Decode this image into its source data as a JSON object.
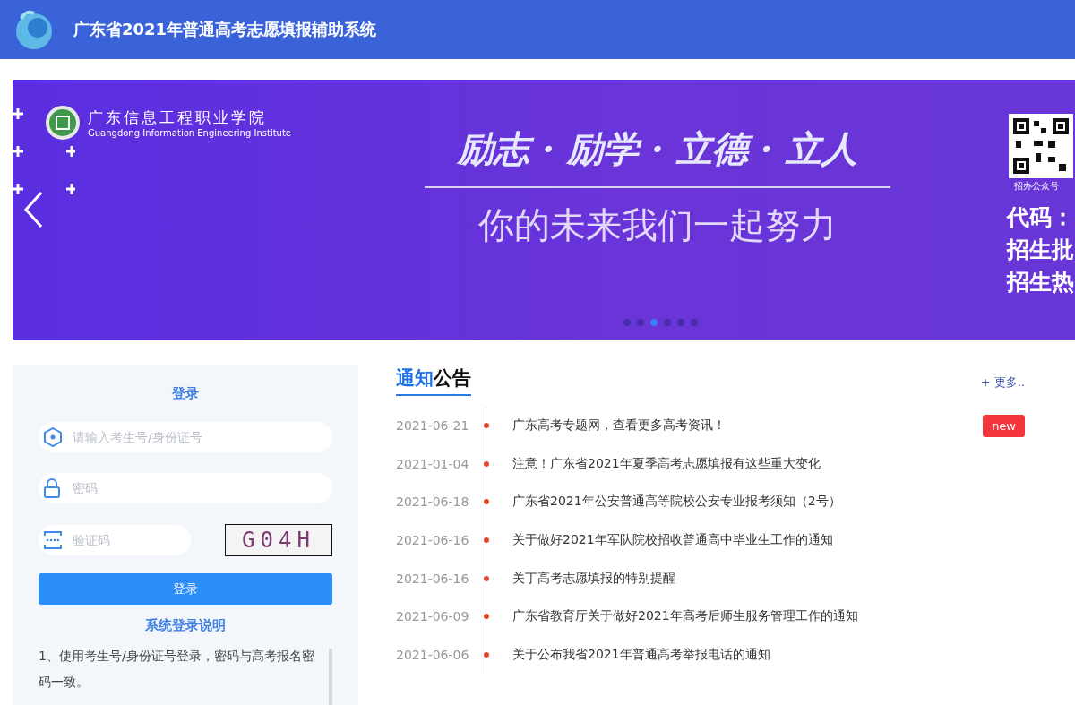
{
  "header": {
    "title": "广东省2021年普通高考志愿填报辅助系统"
  },
  "banner": {
    "school_name": "广东信息工程职业学院",
    "school_name_en": "Guangdong Information Engineering Institute",
    "slogan": "励志 · 励学 · 立德 · 立人",
    "subtitle": "你的未来我们一起努力",
    "qr_caption": "招办公众号",
    "side_lines": [
      "代码：",
      "招生批",
      "招生热"
    ],
    "dots": [
      {
        "selected": false
      },
      {
        "selected": false
      },
      {
        "selected": true
      },
      {
        "selected": false
      },
      {
        "selected": false
      },
      {
        "selected": false
      }
    ]
  },
  "login": {
    "title": "登录",
    "fields": [
      {
        "kind": "user",
        "placeholder": "请输入考生号/身份证号"
      },
      {
        "kind": "password",
        "placeholder": "密码"
      },
      {
        "kind": "captcha",
        "placeholder": "验证码"
      }
    ],
    "captcha_text": "G04H",
    "button": "登录",
    "help_title": "系统登录说明",
    "help_text": "1、使用考生号/身份证号登录，密码与高考报名密码一致。"
  },
  "notices": {
    "title_highlight": "通知",
    "title_rest": "公告",
    "more": "+ 更多..",
    "items": [
      {
        "date": "2021-06-21",
        "text": "广东高考专题网，查看更多高考资讯！",
        "badge": "new"
      },
      {
        "date": "2021-01-04",
        "text": "注意！广东省2021年夏季高考志愿填报有这些重大变化"
      },
      {
        "date": "2021-06-18",
        "text": "广东省2021年公安普通高等院校公安专业报考须知（2号）"
      },
      {
        "date": "2021-06-16",
        "text": "关于做好2021年军队院校招收普通高中毕业生工作的通知"
      },
      {
        "date": "2021-06-16",
        "text": "关丁高考志愿填报的特别提醒"
      },
      {
        "date": "2021-06-09",
        "text": "广东省教育厅关于做好2021年高考后师生服务管理工作的通知"
      },
      {
        "date": "2021-06-06",
        "text": "关于公布我省2021年普通高考举报电话的通知"
      }
    ]
  }
}
